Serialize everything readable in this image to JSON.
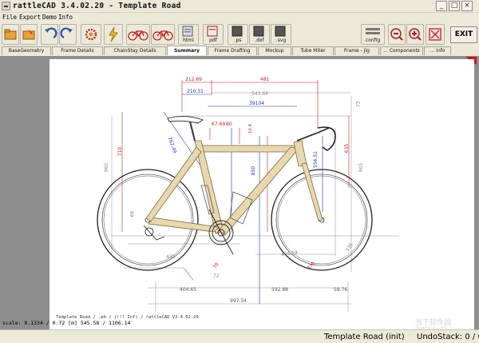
{
  "window": {
    "title": "rattleCAD  3.4.02.20 - Template Road"
  },
  "menu": [
    "File",
    "Export",
    "Demo",
    "Info"
  ],
  "toolbar": {
    "html_label": "html",
    "pdf_label": "pdf",
    "ps_label": ".ps",
    "dxf_label": ".dxf",
    "svg_label": ".svg",
    "config_label": "config",
    "exit_label": "EXIT"
  },
  "tabs": [
    "BaseGeometry",
    "Frame Details",
    "ChainStay Details",
    "Summary",
    "Frame Drafting",
    "Mockup",
    "Tube Miter",
    "Frame - Jig",
    "... Components",
    "... info"
  ],
  "active_tab": "Summary",
  "drawing": {
    "dims_red": [
      "212.69",
      "481",
      "210.31",
      "39104",
      "67.69",
      "80",
      "10.6",
      "710",
      "850",
      "635",
      "556.51",
      "436",
      "70"
    ],
    "dims_blue": [
      "762.49"
    ],
    "dims_gray": [
      "543.69",
      "73",
      "960",
      "905",
      "66",
      "430",
      "406.54",
      "72",
      "336",
      "404.65",
      "592.88",
      "58.76",
      "997.54"
    ],
    "info_line1": "Template Road  /  .pb  /  (!!! Inf)  /  rattleCAD  V3.4.02.20",
    "info_line2": "..."
  },
  "scale_text": "scale: 0.1334 / 0.72  [m]  545.58 / 1106.14",
  "status": {
    "project": "Template Road (init)",
    "undo": "UndoStack:  0 / 0"
  },
  "watermark": {
    "main": "当下软件园",
    "sub": "downxia.com"
  }
}
